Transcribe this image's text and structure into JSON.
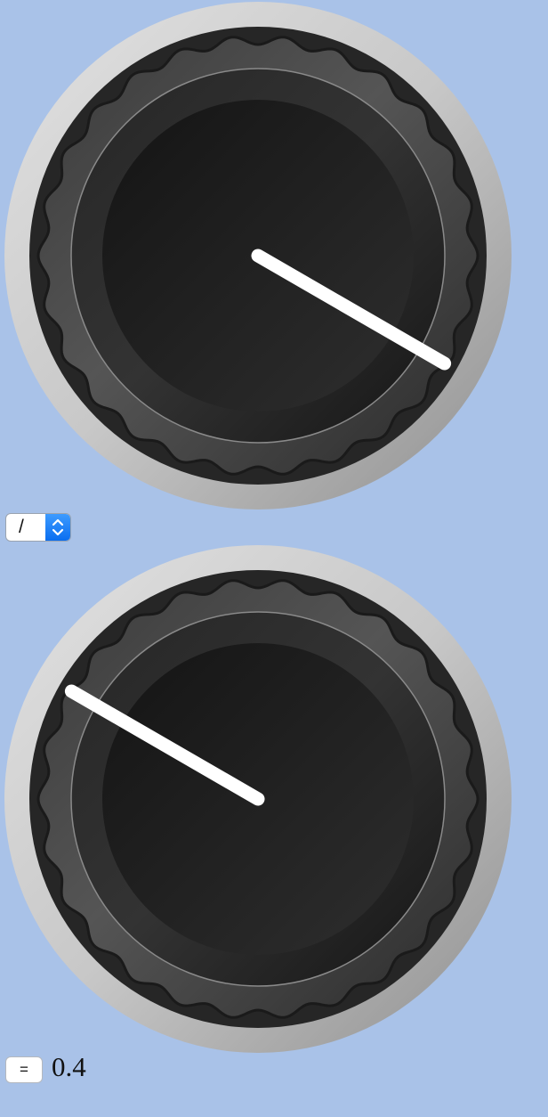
{
  "knobs": [
    {
      "name": "knob-top",
      "pointer_angle_deg": 120
    },
    {
      "name": "knob-bottom",
      "pointer_angle_deg": 300
    }
  ],
  "operator_select": {
    "value": "/"
  },
  "equals_button": {
    "label": "="
  },
  "result": {
    "value": "0.4"
  },
  "colors": {
    "background": "#a9c2e8",
    "pointer": "#ffffff",
    "stepper_accent": "#1a7cf5"
  },
  "icons": {
    "stepper": "chevron-up-down-icon"
  }
}
